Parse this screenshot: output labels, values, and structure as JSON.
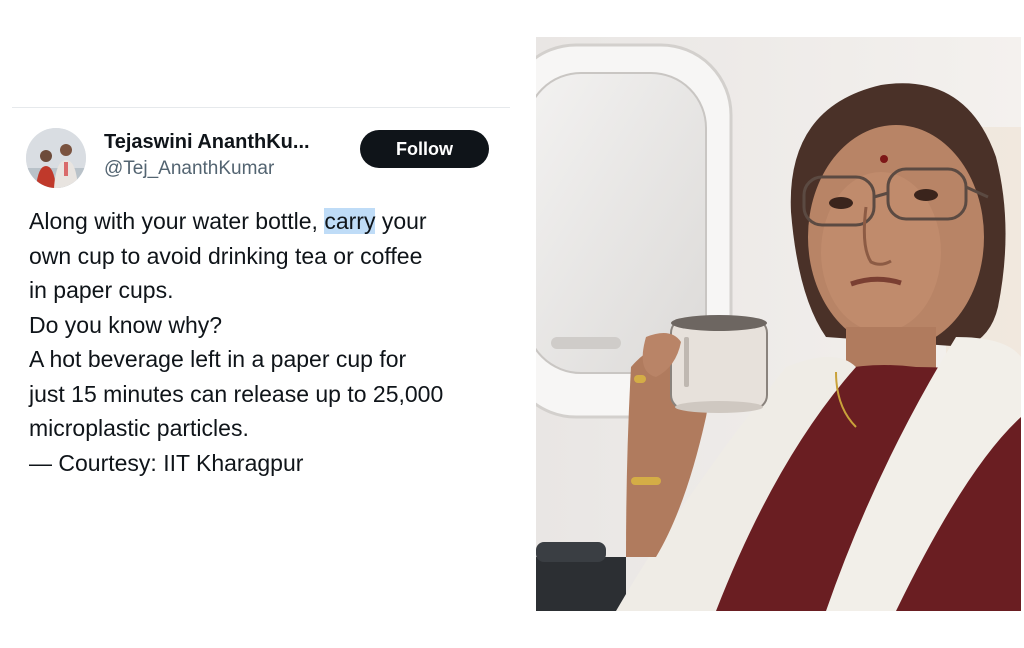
{
  "tweet": {
    "display_name": "Tejaswini AnanthKu...",
    "handle": "@Tej_AnanthKumar",
    "follow_label": "Follow",
    "lines": [
      {
        "before": "Along with your water bottle, ",
        "highlight": "carry",
        "after": " your"
      },
      {
        "text": "own cup to avoid drinking tea or coffee"
      },
      {
        "text": "in paper cups."
      },
      {
        "text": "Do you know why?"
      },
      {
        "text": "A hot beverage left in a paper cup for"
      },
      {
        "text": "just 15 minutes can release up to 25,000"
      },
      {
        "text": "microplastic particles."
      },
      {
        "text": "— Courtesy: IIT Kharagpur"
      }
    ]
  },
  "colors": {
    "follow_button_bg": "#0f1419",
    "follow_button_text": "#ffffff",
    "handle": "#536471",
    "text_highlight": "#bfdcf7"
  },
  "photo": {
    "subject": "woman holding a cup on an airplane"
  }
}
